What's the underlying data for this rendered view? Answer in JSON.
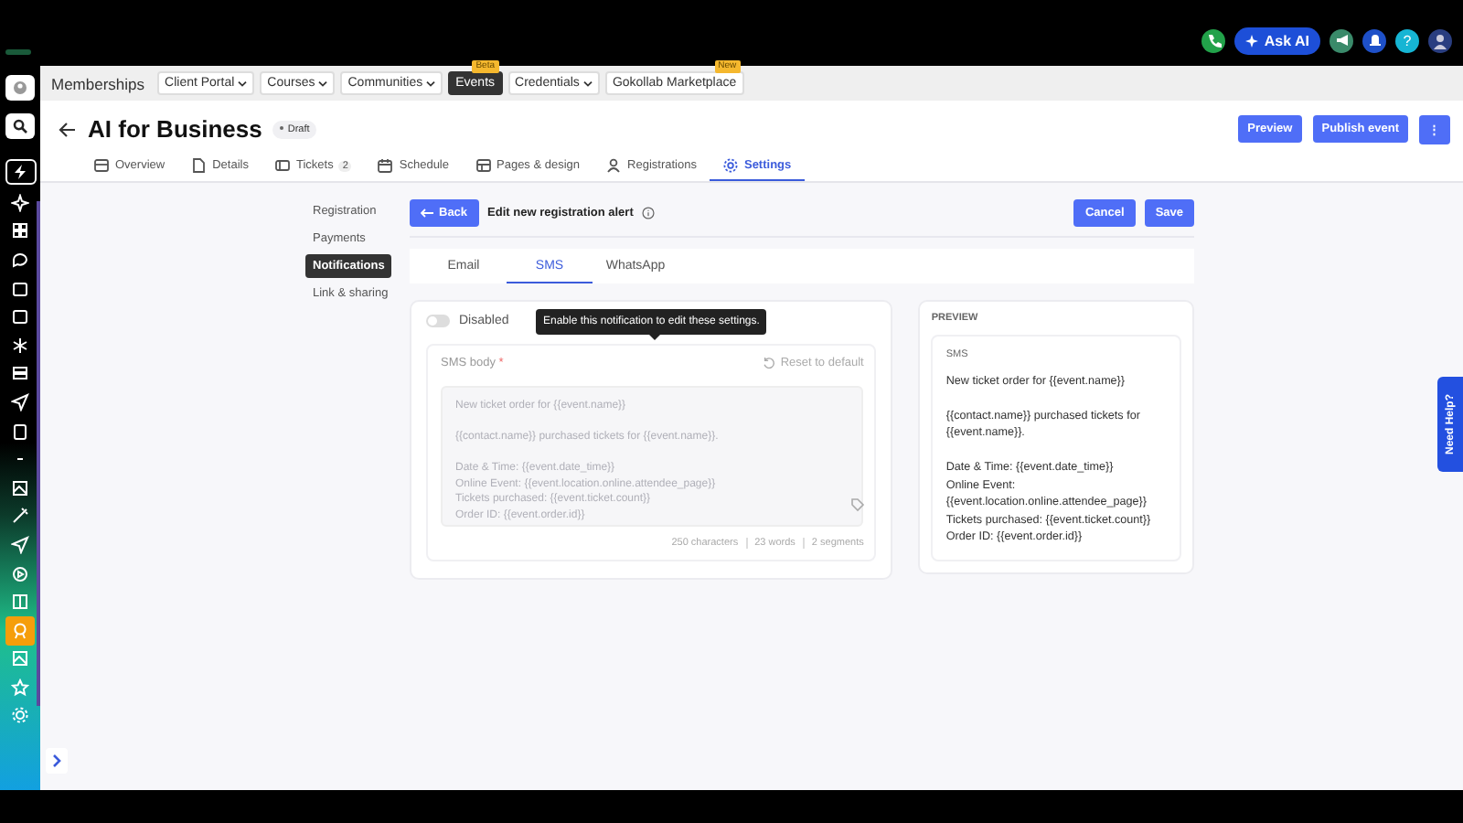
{
  "top_bar": {
    "ask_ai": "Ask AI",
    "help": "?"
  },
  "nav": [
    {
      "label": "Memberships",
      "kind": "title"
    },
    {
      "label": "Client Portal",
      "kind": "dropdown",
      "selected": false
    },
    {
      "label": "Courses",
      "kind": "dropdown",
      "selected": false
    },
    {
      "label": "Communities",
      "kind": "dropdown",
      "selected": false
    },
    {
      "label": "Events",
      "kind": "link",
      "selected": true,
      "badge": "Beta"
    },
    {
      "label": "Credentials",
      "kind": "dropdown",
      "selected": false
    },
    {
      "label": "Gokollab Marketplace",
      "kind": "link",
      "selected": false,
      "badge": "New"
    }
  ],
  "header": {
    "title": "AI for Business",
    "status": "Draft",
    "buttons": [
      "Preview",
      "Publish event"
    ],
    "more": "⋮"
  },
  "tabs": [
    {
      "label": "Overview",
      "selected": false
    },
    {
      "label": "Details",
      "selected": false
    },
    {
      "label": "Tickets",
      "count": "2",
      "selected": false
    },
    {
      "label": "Schedule",
      "selected": false
    },
    {
      "label": "Pages & design",
      "selected": false
    },
    {
      "label": "Registrations",
      "selected": false
    },
    {
      "label": "Settings",
      "selected": true
    }
  ],
  "settings_menu": [
    {
      "label": "Registration",
      "selected": false
    },
    {
      "label": "Payments",
      "selected": false
    },
    {
      "label": "Notifications",
      "selected": true
    },
    {
      "label": "Link & sharing",
      "selected": false
    }
  ],
  "editor": {
    "back": "Back",
    "title": "Edit new registration alert",
    "buttons": [
      "Cancel",
      "Save"
    ]
  },
  "channel_tabs": [
    {
      "label": "Email",
      "selected": false
    },
    {
      "label": "SMS",
      "selected": true
    },
    {
      "label": "WhatsApp",
      "selected": false
    }
  ],
  "toggle": {
    "label": "Disabled",
    "on": false
  },
  "tooltip": "Enable this notification to edit these settings.",
  "sms_body": {
    "label": "SMS body",
    "required": "*",
    "reset": "Reset to default",
    "disabled": true,
    "value": "New ticket order for {{event.name}}\n\n{{contact.name}} purchased tickets for {{event.name}}.\n\nDate & Time: {{event.date_time}}\nOnline Event: {{event.location.online.attendee_page}}\nTickets purchased: {{event.ticket.count}}\nOrder ID: {{event.order.id}}",
    "stats": [
      "250 characters",
      "23 words",
      "2 segments"
    ]
  },
  "preview": {
    "heading": "PREVIEW",
    "channel": "SMS",
    "paragraphs": [
      [
        "New ticket order for {{event.name}}"
      ],
      [
        "{{contact.name}} purchased tickets for {{event.name}}."
      ],
      [
        "Date & Time: {{event.date_time}}",
        "Online Event: {{event.location.online.attendee_page}}",
        "Tickets purchased: {{event.ticket.count}}",
        "Order ID: {{event.order.id}}"
      ]
    ]
  },
  "help_tab": "Need Help?"
}
